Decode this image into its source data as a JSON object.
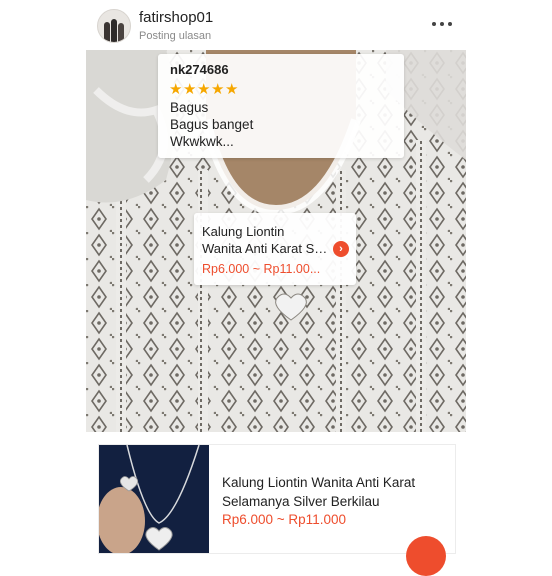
{
  "header": {
    "shop_name": "fatirshop01",
    "subtitle": "Posting ulasan"
  },
  "review": {
    "reviewer": "nk274686",
    "rating": 5,
    "stars": "★★★★★",
    "lines": [
      "Bagus",
      "Bagus banget",
      "Wkwkwk..."
    ]
  },
  "tag": {
    "title_line1": "Kalung Liontin",
    "title_line2": "Wanita Anti Karat Selamanya Silver Berkilau",
    "price": "Rp6.000 ~ Rp11.00...",
    "arrow": "›"
  },
  "shop_badge": "S",
  "product": {
    "title": "Kalung Liontin Wanita Anti Karat Selamanya Silver Berkilau",
    "price": "Rp6.000 ~ Rp11.000"
  },
  "colors": {
    "accent": "#ee4d2d",
    "star": "#f6a700"
  }
}
